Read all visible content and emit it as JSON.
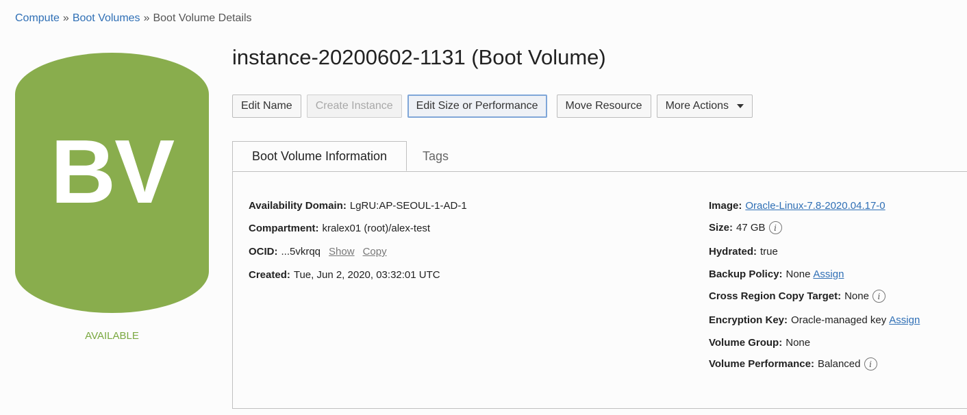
{
  "breadcrumb": {
    "items": [
      "Compute",
      "Boot Volumes",
      "Boot Volume Details"
    ],
    "separator": "»"
  },
  "resource": {
    "icon_text": "BV",
    "icon_color": "#89ad4d",
    "status": "AVAILABLE",
    "status_color": "#7aa840"
  },
  "title": "instance-20200602-1131 (Boot Volume)",
  "actions": {
    "edit_name": "Edit Name",
    "create_instance": "Create Instance",
    "edit_size": "Edit Size or Performance",
    "move_resource": "Move Resource",
    "more_actions": "More Actions"
  },
  "tabs": {
    "info": "Boot Volume Information",
    "tags": "Tags"
  },
  "details_left": {
    "availability_domain": {
      "label": "Availability Domain:",
      "value": "LgRU:AP-SEOUL-1-AD-1"
    },
    "compartment": {
      "label": "Compartment:",
      "value": "kralex01 (root)/alex-test"
    },
    "ocid": {
      "label": "OCID:",
      "value": "...5vkrqq",
      "show": "Show",
      "copy": "Copy"
    },
    "created": {
      "label": "Created:",
      "value": "Tue, Jun 2, 2020, 03:32:01 UTC"
    }
  },
  "details_right": {
    "image": {
      "label": "Image:",
      "value": "Oracle-Linux-7.8-2020.04.17-0"
    },
    "size": {
      "label": "Size:",
      "value": "47 GB"
    },
    "hydrated": {
      "label": "Hydrated:",
      "value": "true"
    },
    "backup_policy": {
      "label": "Backup Policy:",
      "value": "None",
      "link": "Assign"
    },
    "cross_region": {
      "label": "Cross Region Copy Target:",
      "value": "None"
    },
    "encryption_key": {
      "label": "Encryption Key:",
      "value": "Oracle-managed key",
      "link": "Assign"
    },
    "volume_group": {
      "label": "Volume Group:",
      "value": "None"
    },
    "volume_performance": {
      "label": "Volume Performance:",
      "value": "Balanced"
    }
  },
  "icons": {
    "info": "i",
    "dropdown": "caret-down-icon"
  }
}
